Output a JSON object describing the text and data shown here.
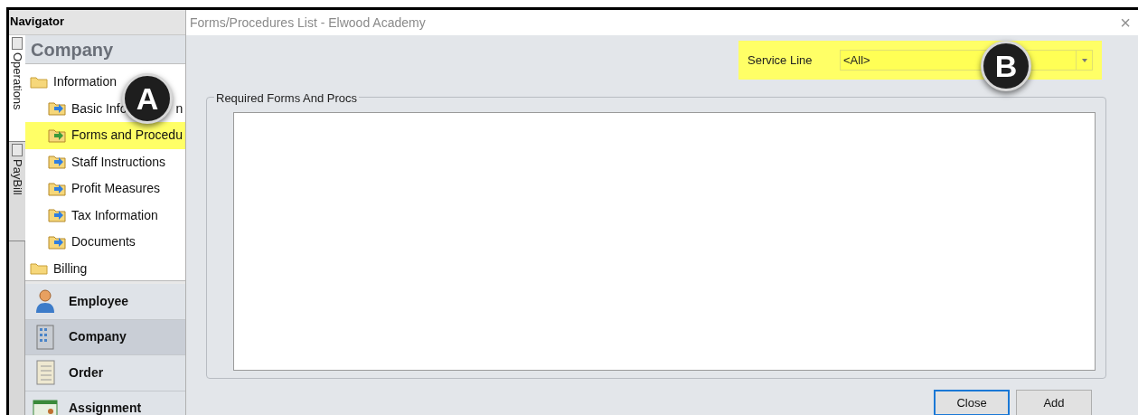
{
  "navigator": {
    "title": "Navigator",
    "side_tabs": [
      {
        "label": "Operations",
        "selected": true
      },
      {
        "label": "PayBill",
        "selected": false
      }
    ],
    "section_title": "Company",
    "tree": [
      {
        "label": "Information",
        "kind": "folder",
        "selected": false,
        "children": [
          {
            "label": "Basic Info",
            "label_end": "n",
            "kind": "page",
            "selected": false
          },
          {
            "label": "Forms and Procedu",
            "kind": "page",
            "selected": true
          },
          {
            "label": "Staff Instructions",
            "kind": "page",
            "selected": false
          },
          {
            "label": "Profit Measures",
            "kind": "page",
            "selected": false
          },
          {
            "label": "Tax Information",
            "kind": "page",
            "selected": false
          },
          {
            "label": "Documents",
            "kind": "page",
            "selected": false
          }
        ]
      },
      {
        "label": "Billing",
        "kind": "folder",
        "selected": false
      }
    ],
    "modules": [
      {
        "label": "Employee",
        "kind": "person",
        "selected": false
      },
      {
        "label": "Company",
        "kind": "building",
        "selected": true
      },
      {
        "label": "Order",
        "kind": "ledger",
        "selected": false
      },
      {
        "label": "Assignment",
        "kind": "card",
        "selected": false
      }
    ]
  },
  "dialog": {
    "title": "Forms/Procedures List - Elwood Academy",
    "close": "×",
    "service_line": {
      "label": "Service Line",
      "value": "<All>",
      "highlighted": true
    },
    "group": {
      "title": "Required Forms And Procs"
    },
    "buttons": [
      {
        "label": "Close",
        "selected": true
      },
      {
        "label": "Add",
        "selected": false
      }
    ]
  },
  "callouts": [
    {
      "label": "A",
      "kind": "tree"
    },
    {
      "label": "B",
      "kind": "service_line"
    }
  ]
}
